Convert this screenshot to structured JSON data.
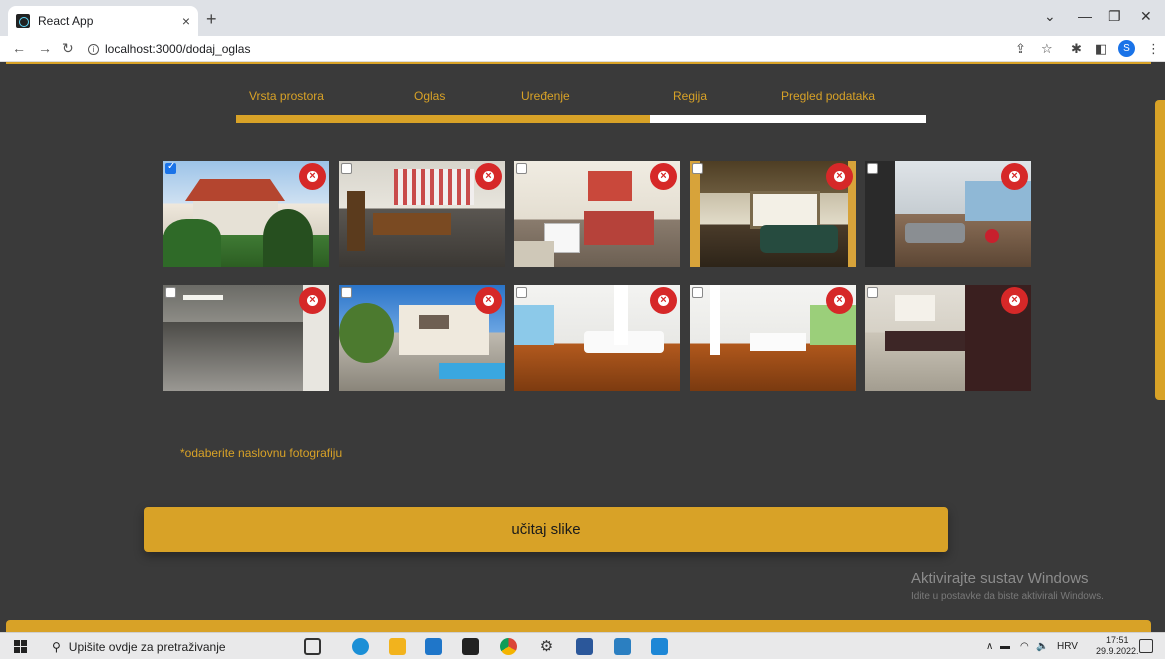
{
  "browser": {
    "tab_title": "React App",
    "tab_close": "×",
    "new_tab": "+",
    "url": "localhost:3000/dodaj_oglas",
    "profile_initial": "S"
  },
  "steps": [
    {
      "label": "Vrsta prostora"
    },
    {
      "label": "Oglas"
    },
    {
      "label": "Uređenje"
    },
    {
      "label": "Regija"
    },
    {
      "label": "Pregled podataka"
    }
  ],
  "progress_fraction": 0.6,
  "photos": [
    {
      "scene": "house-exterior",
      "selected": true
    },
    {
      "scene": "dining-room",
      "selected": false
    },
    {
      "scene": "kitchen",
      "selected": false
    },
    {
      "scene": "living-room-green-sofa",
      "selected": false
    },
    {
      "scene": "modern-living-room",
      "selected": false
    },
    {
      "scene": "garage",
      "selected": false
    },
    {
      "scene": "pool-house",
      "selected": false
    },
    {
      "scene": "white-living-room",
      "selected": false
    },
    {
      "scene": "white-dining-room",
      "selected": false
    },
    {
      "scene": "dark-kitchen",
      "selected": false
    }
  ],
  "hint_text": "*odaberite naslovnu fotografiju",
  "upload_button_label": "učitaj slike",
  "watermark": {
    "title": "Aktivirajte sustav Windows",
    "subtitle": "Idite u postavke da biste aktivirali Windows."
  },
  "taskbar": {
    "search_placeholder": "Upišite ovdje za pretraživanje",
    "language": "HRV",
    "time": "17:51",
    "date": "29.9.2022."
  },
  "colors": {
    "accent": "#d8a227",
    "background": "#3a3a3a",
    "remove": "#d62828"
  }
}
